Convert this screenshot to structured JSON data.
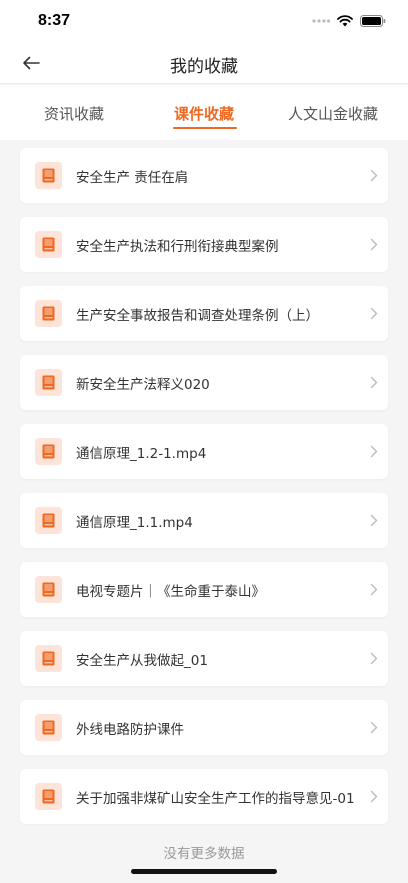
{
  "status_bar": {
    "time": "8:37"
  },
  "header": {
    "title": "我的收藏",
    "back_icon": "arrow-left-icon"
  },
  "tabs": [
    {
      "label": "资讯收藏",
      "active": false
    },
    {
      "label": "课件收藏",
      "active": true
    },
    {
      "label": "人文山金收藏",
      "active": false
    }
  ],
  "items": [
    {
      "label": "安全生产 责任在肩"
    },
    {
      "label": "安全生产执法和行刑衔接典型案例"
    },
    {
      "label": "生产安全事故报告和调查处理条例（上）"
    },
    {
      "label": "新安全生产法释义020"
    },
    {
      "label": "通信原理_1.2-1.mp4"
    },
    {
      "label": "通信原理_1.1.mp4"
    },
    {
      "label": "电视专题片｜《生命重于泰山》"
    },
    {
      "label": "安全生产从我做起_01"
    },
    {
      "label": "外线电路防护课件"
    },
    {
      "label": "关于加强非煤矿山安全生产工作的指导意见-01"
    }
  ],
  "footer": {
    "text": "没有更多数据"
  },
  "colors": {
    "accent": "#ee6a22",
    "icon_bg": "#fde3d8",
    "background": "#f5f5f5"
  }
}
